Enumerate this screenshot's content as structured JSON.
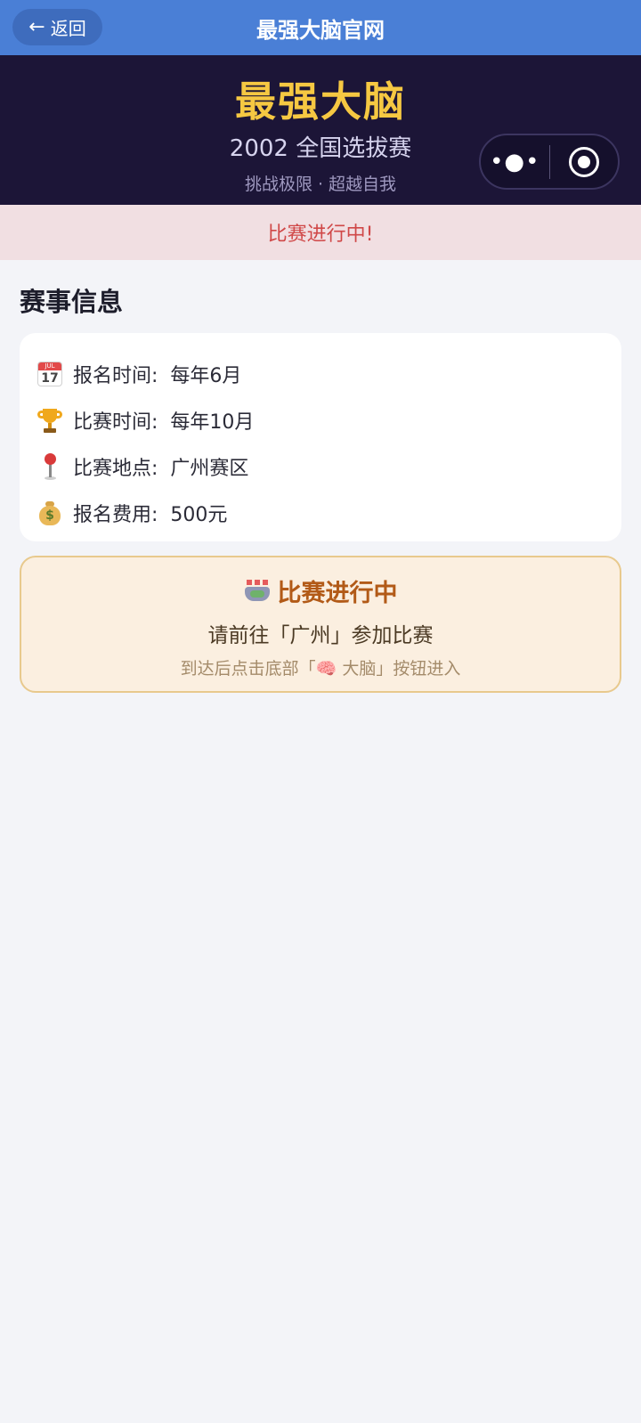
{
  "navbar": {
    "back_label": "返回",
    "title": "最强大脑官网"
  },
  "hero": {
    "title": "最强大脑",
    "subtitle": "2002 全国选拔赛",
    "slogan": "挑战极限 · 超越自我",
    "more_glyph": "•●•"
  },
  "status_strip": {
    "text": "比赛进行中!"
  },
  "section": {
    "title": "赛事信息"
  },
  "info": {
    "calendar_icon_month": "JUL",
    "calendar_icon_day": "17",
    "items": [
      {
        "icon": "calendar-icon",
        "label": "报名时间:",
        "value": "每年6月"
      },
      {
        "icon": "trophy-icon",
        "label": "比赛时间:",
        "value": "每年10月"
      },
      {
        "icon": "pushpin-icon",
        "label": "比赛地点:",
        "value": "广州赛区"
      },
      {
        "icon": "money-bag-icon",
        "label": "报名费用:",
        "value": "500元"
      }
    ]
  },
  "notice": {
    "icon": "stadium-icon",
    "title": "比赛进行中",
    "line": "请前往「广州」参加比赛",
    "hint": "到达后点击底部「🧠 大脑」按钮进入"
  },
  "colors": {
    "navbar_bg": "#4a7fd6",
    "hero_bg": "#1c1537",
    "hero_title": "#f6c842",
    "status_text": "#d04848",
    "notice_title": "#b25a17",
    "notice_bg": "#fbefe0"
  }
}
